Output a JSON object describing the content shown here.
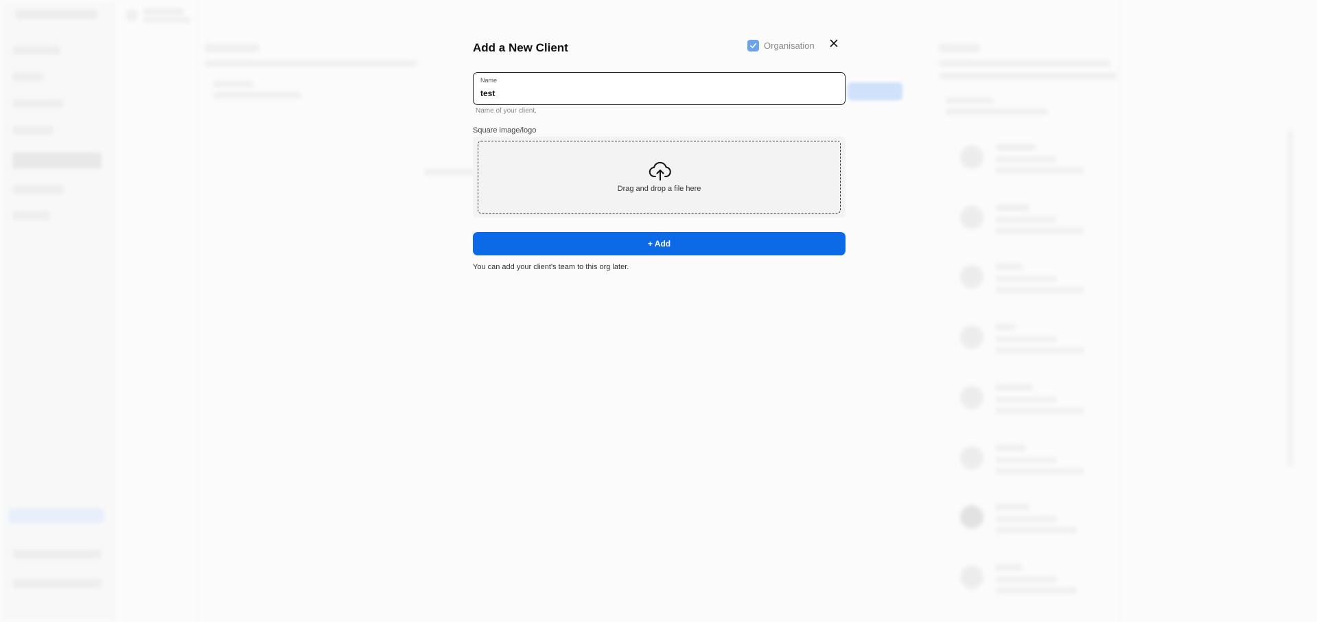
{
  "modal": {
    "title": "Add a New Client",
    "organisation_label": "Organisation",
    "organisation_checked": true,
    "name_field": {
      "label": "Name",
      "value": "test",
      "helper": "Name of your client."
    },
    "image_section": {
      "label": "Square image/logo",
      "dropzone_text": "Drag and drop a file here"
    },
    "add_button_label": "+ Add",
    "footer_note": "You can add your client's team to this org later."
  },
  "icons": {
    "close": "close-icon",
    "checkbox": "check-icon",
    "upload": "cloud-upload-icon"
  },
  "colors": {
    "accent": "#0c6ae6",
    "checkbox": "#6aa3ec"
  }
}
